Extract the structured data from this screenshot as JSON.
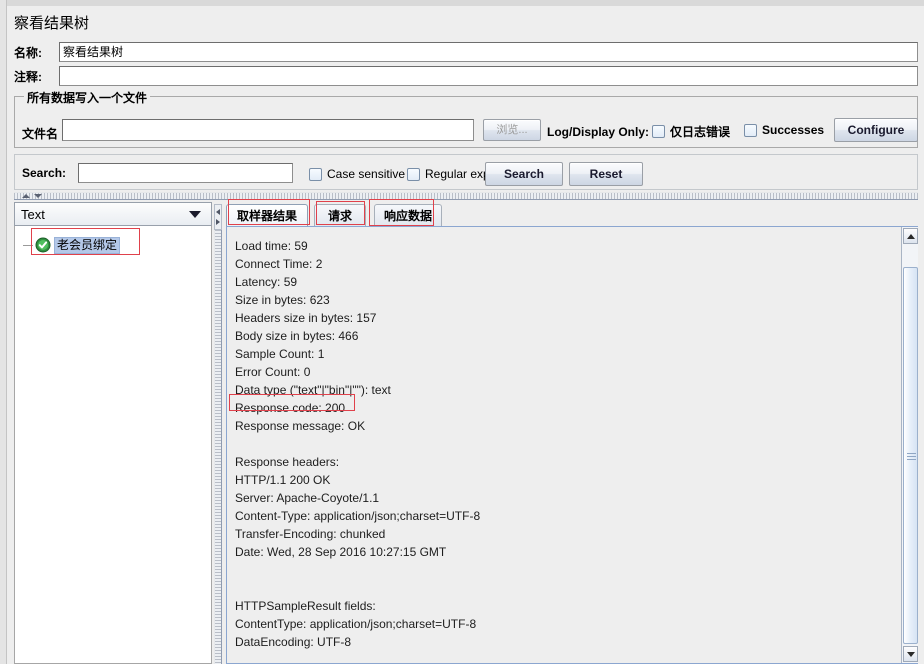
{
  "window": {
    "title": "察看结果树"
  },
  "form": {
    "name_label": "名称:",
    "name_value": "察看结果树",
    "comment_label": "注释:",
    "comment_value": ""
  },
  "file_group": {
    "title": "所有数据写入一个文件",
    "filename_label": "文件名",
    "filename_value": "",
    "browse_button": "浏览...",
    "log_display_label": "Log/Display Only:",
    "errors_only_checkbox": "仅日志错误",
    "successes_checkbox": "Successes",
    "configure_button": "Configure"
  },
  "search_bar": {
    "label": "Search:",
    "value": "",
    "case_sensitive_checkbox": "Case sensitive",
    "regular_exp_checkbox": "Regular exp.",
    "search_button": "Search",
    "reset_button": "Reset"
  },
  "left_pane": {
    "renderer_selected": "Text",
    "tree_item": "老会员绑定",
    "tree_icon": "green-shield-success-icon"
  },
  "tabs": [
    {
      "label": "取样器结果",
      "active": true
    },
    {
      "label": "请求",
      "active": false
    },
    {
      "label": "响应数据",
      "active": false
    }
  ],
  "result_lines": [
    "Load time: 59",
    "Connect Time: 2",
    "Latency: 59",
    "Size in bytes: 623",
    "Headers size in bytes: 157",
    "Body size in bytes: 466",
    "Sample Count: 1",
    "Error Count: 0",
    "Data type (\"text\"|\"bin\"|\"\"): text",
    "Response code: 200",
    "Response message: OK",
    "",
    "Response headers:",
    "HTTP/1.1 200 OK",
    "Server: Apache-Coyote/1.1",
    "Content-Type: application/json;charset=UTF-8",
    "Transfer-Encoding: chunked",
    "Date: Wed, 28 Sep 2016 10:27:15 GMT",
    "",
    "",
    "HTTPSampleResult fields:",
    "ContentType: application/json;charset=UTF-8",
    "DataEncoding: UTF-8"
  ],
  "annotation_color": "#e0414b",
  "annotations": [
    {
      "name": "tree-item-highlight"
    },
    {
      "name": "tab-sampler-result-highlight"
    },
    {
      "name": "tab-request-highlight"
    },
    {
      "name": "tab-response-data-highlight"
    },
    {
      "name": "response-code-highlight"
    }
  ]
}
